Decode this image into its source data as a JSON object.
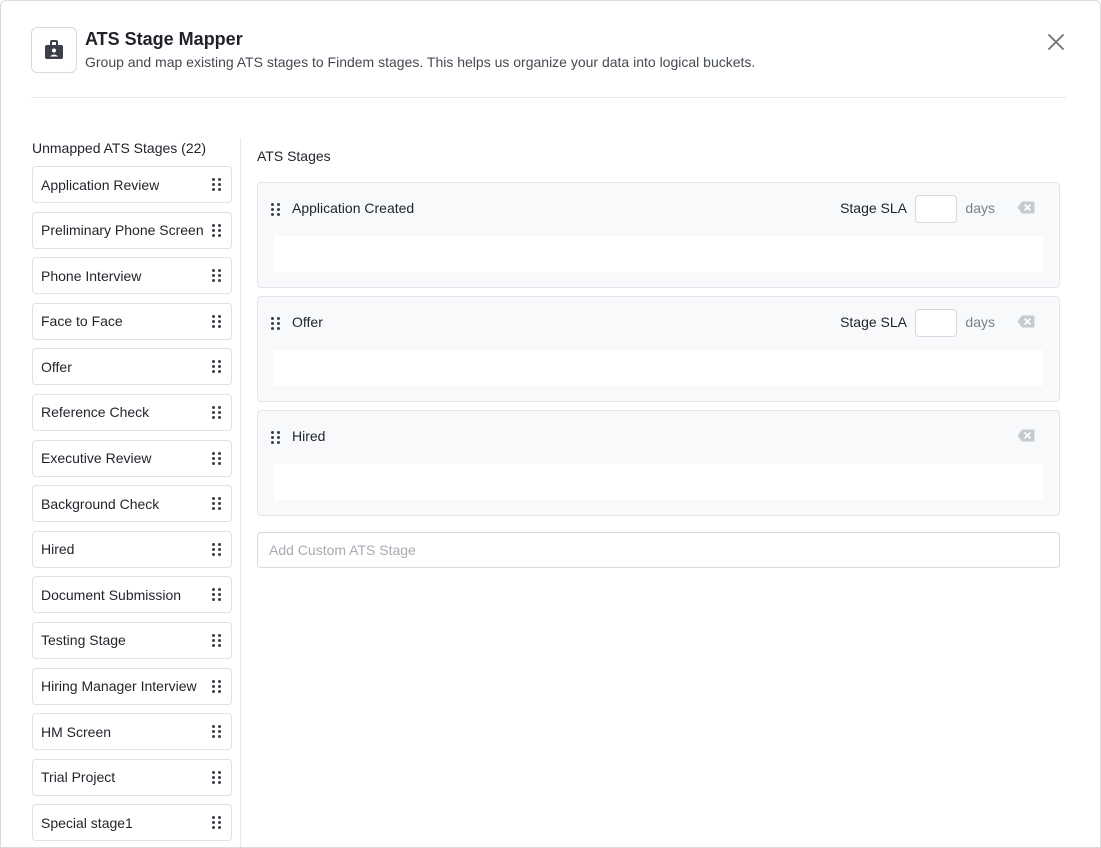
{
  "dialog": {
    "title": "ATS Stage Mapper",
    "subtitle": "Group and map existing ATS stages to Findem stages. This helps us organize your data into logical buckets.",
    "logo_icon": "id-badge-icon",
    "close_icon": "close-icon"
  },
  "unmapped": {
    "heading": "Unmapped ATS Stages (22)",
    "items": [
      {
        "label": "Application Review"
      },
      {
        "label": "Preliminary Phone Screen"
      },
      {
        "label": "Phone Interview"
      },
      {
        "label": "Face to Face"
      },
      {
        "label": "Offer"
      },
      {
        "label": "Reference Check"
      },
      {
        "label": "Executive Review"
      },
      {
        "label": "Background Check"
      },
      {
        "label": "Hired"
      },
      {
        "label": "Document Submission"
      },
      {
        "label": "Testing Stage"
      },
      {
        "label": "Hiring Manager Interview"
      },
      {
        "label": "HM Screen"
      },
      {
        "label": "Trial Project"
      },
      {
        "label": "Special stage1"
      }
    ]
  },
  "mapped": {
    "heading": "ATS Stages",
    "sla_label": "Stage SLA",
    "sla_unit": "days",
    "stages": [
      {
        "name": "Application Created",
        "sla_value": "",
        "has_sla": true
      },
      {
        "name": "Offer",
        "sla_value": "",
        "has_sla": true
      },
      {
        "name": "Hired",
        "sla_value": "",
        "has_sla": false
      }
    ],
    "add_placeholder": "Add Custom ATS Stage",
    "add_value": ""
  },
  "colors": {
    "border": "#dfe1e5",
    "card_bg": "#f8f9fa",
    "text": "#1f2329",
    "muted": "#7a8088"
  }
}
